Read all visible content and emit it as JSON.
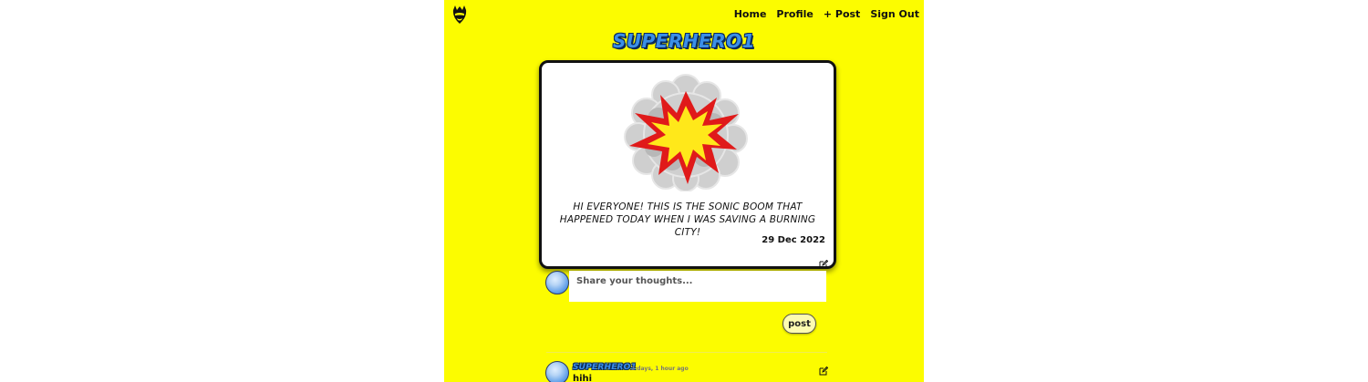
{
  "nav": {
    "items": [
      {
        "label": "Home"
      },
      {
        "label": "Profile"
      },
      {
        "label": "+ Post"
      },
      {
        "label": "Sign Out"
      }
    ]
  },
  "profile": {
    "username": "SUPERHERO1"
  },
  "post": {
    "image": "sonic-boom-explosion",
    "caption": "Hi everyone! This is the sonic boom that happened today when I was saving a burning city!",
    "date": "29 Dec 2022"
  },
  "composer": {
    "placeholder": "Share your thoughts...",
    "submit_label": "post"
  },
  "comments": [
    {
      "author": "SUPERHERO1",
      "time": "2 days, 1 hour ago",
      "text": "hihi"
    }
  ],
  "colors": {
    "background": "#fcfc00",
    "title_fill": "#3b8fe8",
    "title_outline": "#0a2a5c",
    "explosion_red": "#e01a1a",
    "explosion_yellow": "#ffe81a"
  },
  "icons": {
    "logo": "hero-mask-logo-icon",
    "edit": "edit-pencil-icon"
  }
}
